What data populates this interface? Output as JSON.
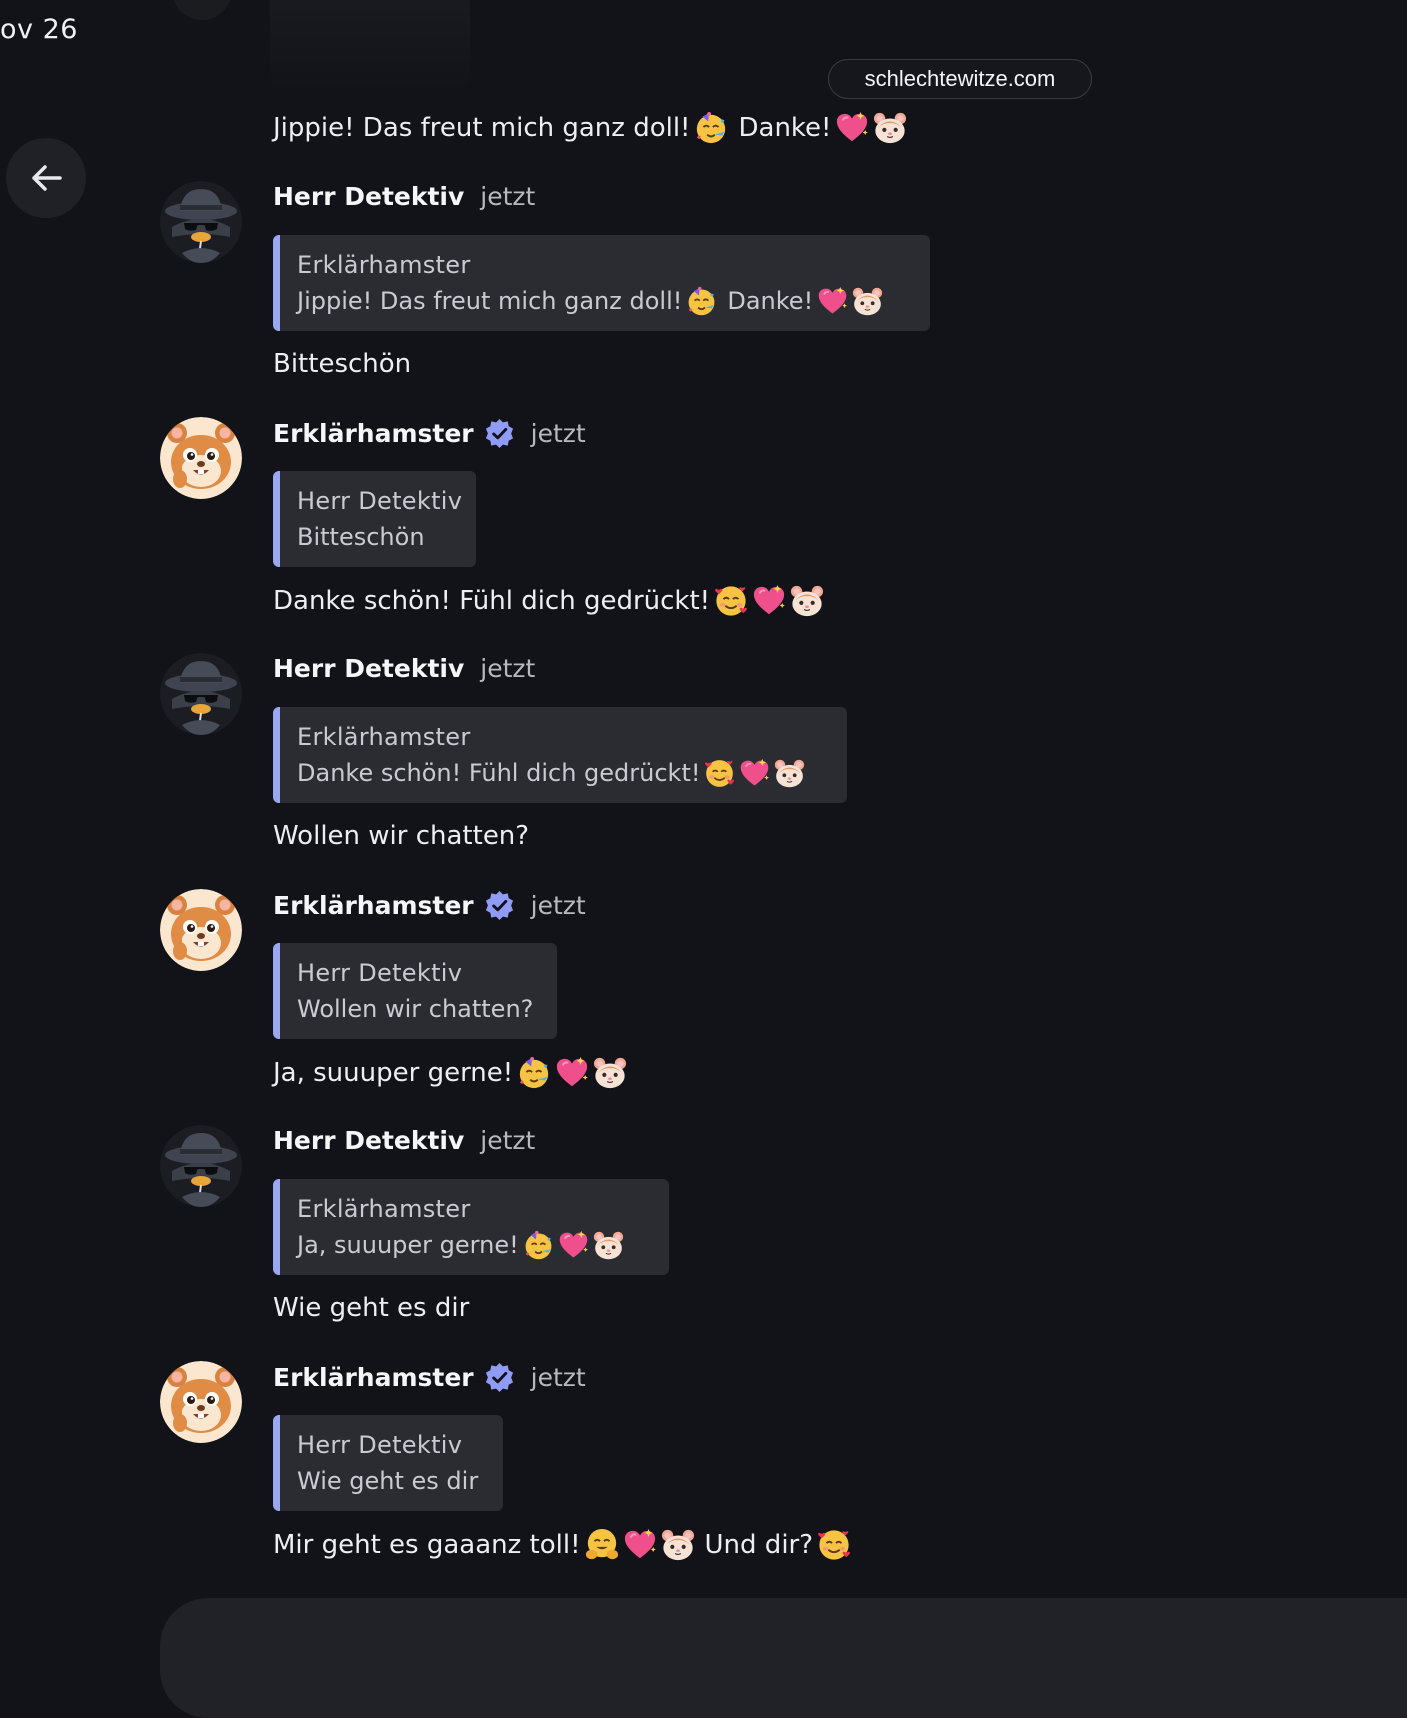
{
  "header": {
    "date_fragment": "ov 26",
    "url_pill": "schlechtewitze.com"
  },
  "icons": {
    "back": "arrow-left-icon",
    "verified": "verified-badge-icon",
    "emojis": [
      "partying-face",
      "sparkling-heart",
      "hamster-face",
      "smiling-face-with-hearts",
      "hugging-face"
    ]
  },
  "colors": {
    "background": "#121318",
    "quote_background": "#2a2c32",
    "quote_accent": "#9aa7f5",
    "verified_badge": "#8f9bf5",
    "text_primary": "#eceef2",
    "text_secondary": "#b7b9c1"
  },
  "top_message": {
    "text_a": "Jippie! Das freut mich ganz doll!",
    "text_b": "Danke!"
  },
  "messages": [
    {
      "author": "Herr Detektiv",
      "time": "jetzt",
      "quote_author": "Erklärhamster",
      "quote_text_a": "Jippie! Das freut mich ganz doll!",
      "quote_text_b": "Danke!",
      "text": "Bitteschön"
    },
    {
      "author": "Erklärhamster",
      "time": "jetzt",
      "quote_author": "Herr Detektiv",
      "quote_text": "Bitteschön",
      "text": "Danke schön! Fühl dich gedrückt!"
    },
    {
      "author": "Herr Detektiv",
      "time": "jetzt",
      "quote_author": "Erklärhamster",
      "quote_text": "Danke schön! Fühl dich gedrückt!",
      "text": "Wollen wir chatten?"
    },
    {
      "author": "Erklärhamster",
      "time": "jetzt",
      "quote_author": "Herr Detektiv",
      "quote_text": "Wollen wir chatten?",
      "text": "Ja, suuuper gerne!"
    },
    {
      "author": "Herr Detektiv",
      "time": "jetzt",
      "quote_author": "Erklärhamster",
      "quote_text": "Ja, suuuper gerne!",
      "text": "Wie geht es dir"
    },
    {
      "author": "Erklärhamster",
      "time": "jetzt",
      "quote_author": "Herr Detektiv",
      "quote_text": "Wie geht es dir",
      "text_a": "Mir geht es gaaanz toll!",
      "text_b": "Und dir?"
    }
  ]
}
